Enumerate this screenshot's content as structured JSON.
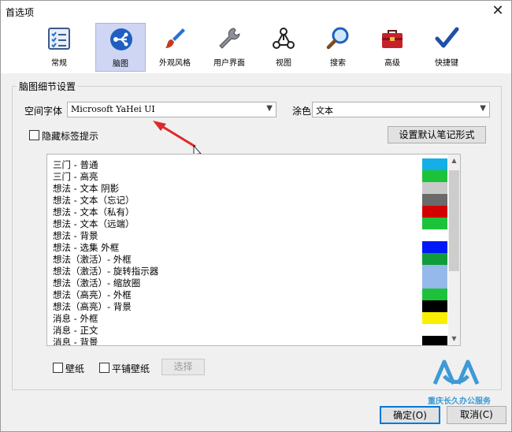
{
  "window": {
    "title": "首选项"
  },
  "tabs": [
    {
      "label": "常规",
      "icon": "checklist-icon",
      "active": false
    },
    {
      "label": "脑图",
      "icon": "mindmap-icon",
      "active": true
    },
    {
      "label": "外观风格",
      "icon": "brush-icon",
      "active": false
    },
    {
      "label": "用户界面",
      "icon": "wrench-icon",
      "active": false
    },
    {
      "label": "视图",
      "icon": "graph-icon",
      "active": false
    },
    {
      "label": "搜索",
      "icon": "magnifier-icon",
      "active": false
    },
    {
      "label": "高级",
      "icon": "toolbox-icon",
      "active": false
    },
    {
      "label": "快捷键",
      "icon": "checkmark-icon",
      "active": false
    }
  ],
  "group": {
    "title": "脑图细节设置",
    "font_label": "空间字体",
    "font_value": "Microsoft YaHei UI",
    "color_label": "涂色",
    "color_value": "文本",
    "hide_tag_label": "隐藏标签提示",
    "default_style_button": "设置默认笔记形式",
    "wallpaper_label": "壁纸",
    "tile_wallpaper_label": "平铺壁纸",
    "select_button": "选择"
  },
  "color_list": [
    {
      "text": "三门 - 普通",
      "color": "#16aee7"
    },
    {
      "text": "三门 - 高亮",
      "color": "#1cc33a"
    },
    {
      "text": "想法 - 文本 阴影",
      "color": "#c9c9c9"
    },
    {
      "text": "想法 - 文本（忘记）",
      "color": "#6a6a6a"
    },
    {
      "text": "想法 - 文本（私有）",
      "color": "#d20000"
    },
    {
      "text": "想法 - 文本（远端）",
      "color": "#1cc33a"
    },
    {
      "text": "想法 - 背景",
      "color": "#ffffff"
    },
    {
      "text": "想法 - 选集 外框",
      "color": "#0019f5"
    },
    {
      "text": "想法（激活）- 外框",
      "color": "#119c3a"
    },
    {
      "text": "想法（激活）- 旋转指示器",
      "color": "#95b9ea"
    },
    {
      "text": "想法（激活）- 缩放圈",
      "color": "#95b9ea"
    },
    {
      "text": "想法（高亮）- 外框",
      "color": "#1cc33a"
    },
    {
      "text": "想法（高亮）- 背景",
      "color": "#000000"
    },
    {
      "text": "消息 - 外框",
      "color": "#f8f000"
    },
    {
      "text": "消息 - 正文",
      "color": "#ffffff"
    },
    {
      "text": "消息 - 背景",
      "color": "#000000"
    }
  ],
  "footer": {
    "ok": "确定(O)",
    "cancel": "取消(C)",
    "watermark": "重庆长久办公服务"
  }
}
